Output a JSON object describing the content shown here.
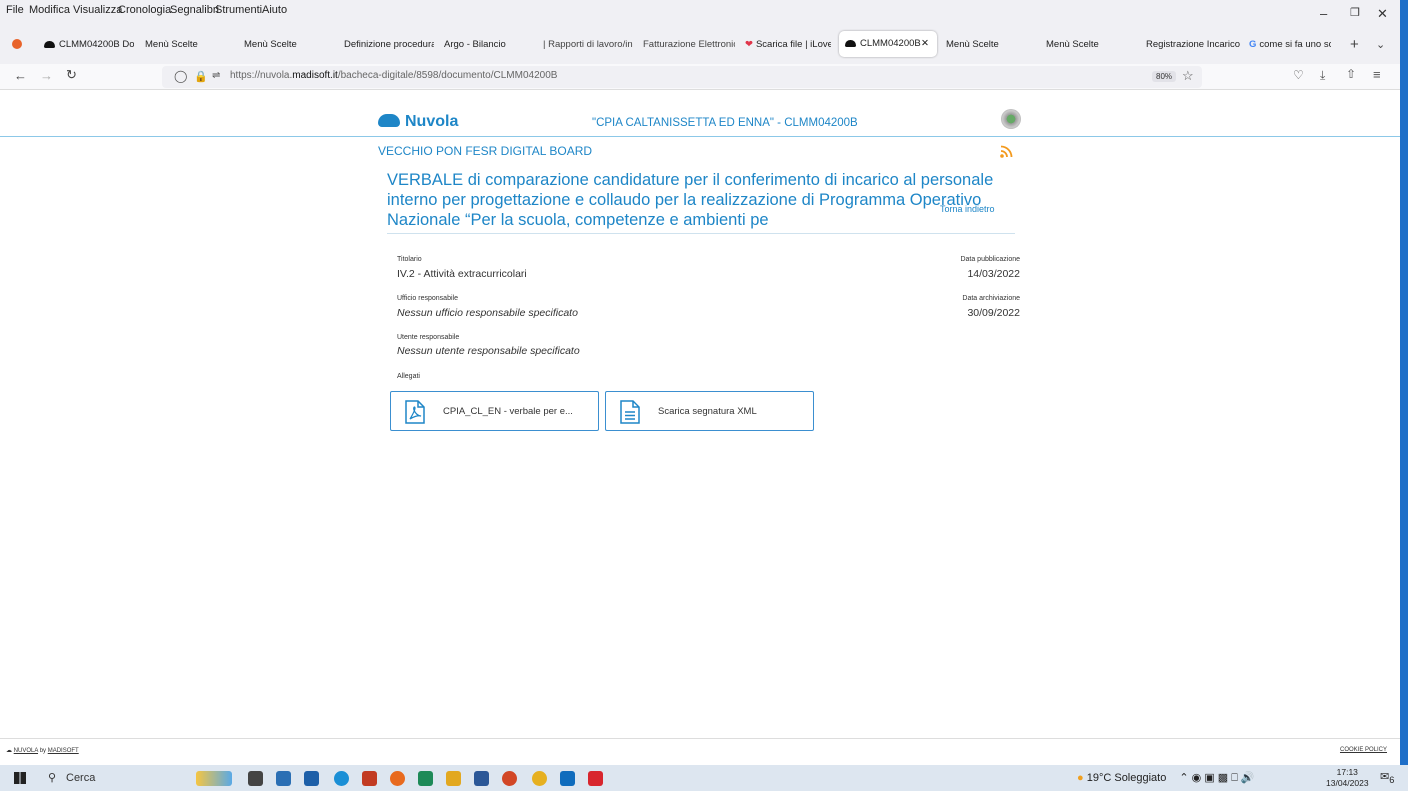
{
  "menubar": {
    "items": [
      "File",
      "Modifica",
      "Visualizza",
      "Cronologia",
      "Segnalibri",
      "Strumenti",
      "Aiuto"
    ]
  },
  "tabs": [
    {
      "label": "CLMM04200B Do"
    },
    {
      "label": "Menù Scelte"
    },
    {
      "label": "Menù Scelte"
    },
    {
      "label": "Definizione procedura"
    },
    {
      "label": "Argo - Bilancio"
    },
    {
      "label": "| Rapporti di lavoro/in"
    },
    {
      "label": "Fatturazione Elettronic"
    },
    {
      "label": "Scarica file | iLove"
    },
    {
      "label": "CLMM04200B"
    },
    {
      "label": "Menù Scelte"
    },
    {
      "label": "Menù Scelte"
    },
    {
      "label": "Registrazione Incarico"
    },
    {
      "label": "come si fa uno sc"
    }
  ],
  "nav": {
    "url_prefix": "https://nuvola.",
    "url_domain": "madisoft.it",
    "url_path": "/bacheca-digitale/8598/documento/CLMM04200B",
    "zoom": "80%"
  },
  "header": {
    "brand": "Nuvola",
    "school": "\"CPIA CALTANISSETTA ED ENNA\" - CLMM04200B"
  },
  "document": {
    "section": "VECCHIO PON FESR DIGITAL BOARD",
    "title_lines": [
      "VERBALE di comparazione candidature per il conferimento di incarico al personale",
      "interno per progettazione e collaudo per la realizzazione di Programma Operativo",
      "Nazionale “Per la scuola, competenze e ambienti pe"
    ],
    "overlay_text": "Torna indietro",
    "titolario_label": "Titolario",
    "titolario_value": "IV.2 - Attività extracurricolari",
    "ufficio_label": "Ufficio responsabile",
    "ufficio_value": "Nessun ufficio responsabile specificato",
    "utente_label": "Utente responsabile",
    "utente_value": "Nessun utente responsabile specificato",
    "pubblicazione_label": "Data pubblicazione",
    "pubblicazione_value": "14/03/2022",
    "archiviazione_label": "Data archiviazione",
    "archiviazione_value": "30/09/2022",
    "allegati_label": "Allegati",
    "attachments": [
      {
        "label": "CPIA_CL_EN - verbale per e...",
        "icon": "pdf-file-icon"
      },
      {
        "label": "Scarica segnatura XML",
        "icon": "document-file-icon"
      }
    ]
  },
  "footer": {
    "left_a": "NUVOLA",
    "left_b": "by",
    "left_c": "MADISOFT",
    "right": "COOKIE POLICY"
  },
  "taskbar": {
    "search": "Cerca",
    "weather": "19°C  Soleggiato",
    "time": "17:13",
    "date": "13/04/2023",
    "notifications": "6"
  }
}
